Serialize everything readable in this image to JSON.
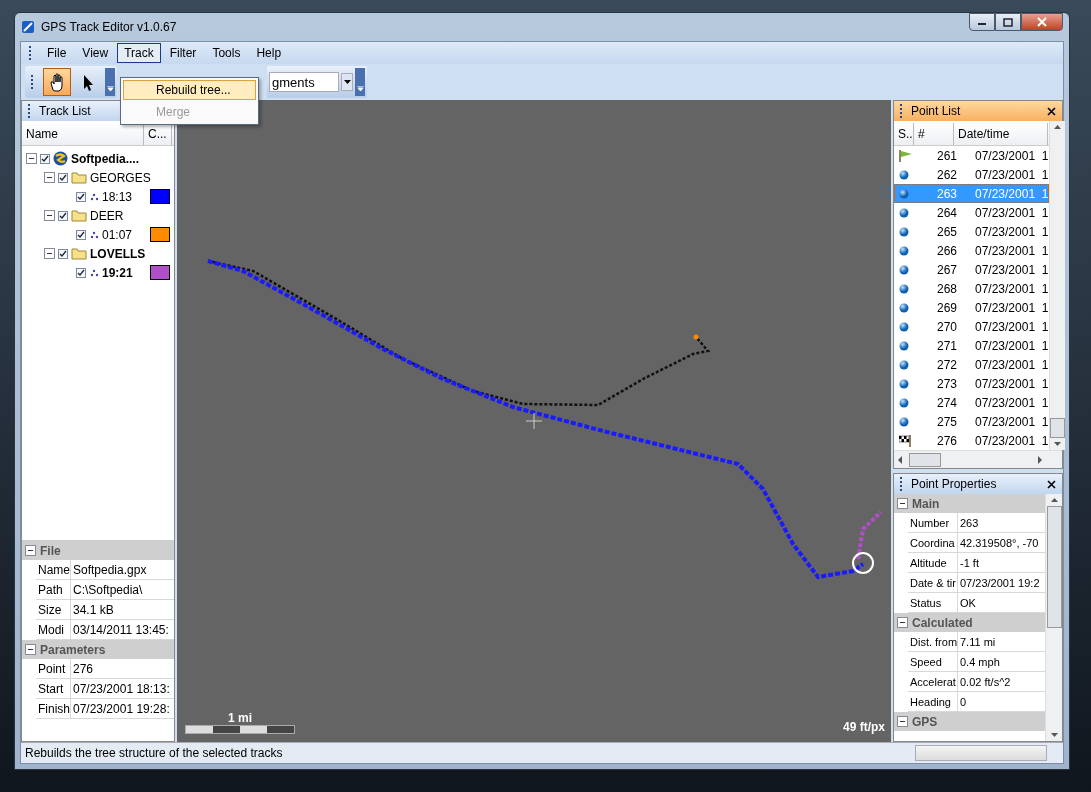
{
  "window": {
    "title": "GPS Track Editor v1.0.67"
  },
  "menu": [
    {
      "label": "File",
      "selected": false
    },
    {
      "label": "View",
      "selected": false
    },
    {
      "label": "Track",
      "selected": true
    },
    {
      "label": "Filter",
      "selected": false
    },
    {
      "label": "Tools",
      "selected": false
    },
    {
      "label": "Help",
      "selected": false
    }
  ],
  "open_menu": {
    "items": [
      {
        "label": "Rebuild tree...",
        "disabled": false,
        "selected": true
      },
      {
        "label": "Merge",
        "disabled": true,
        "selected": false
      }
    ]
  },
  "toolbar": {
    "tools": [
      {
        "kind": "hand",
        "selected": true
      },
      {
        "kind": "pointer",
        "selected": false
      }
    ],
    "combo": {
      "value": "gments"
    }
  },
  "track_list": {
    "title": "Track List",
    "columns": [
      "Name",
      "C..."
    ],
    "tree": [
      {
        "kind": "file",
        "label": "Softpedia....",
        "checked": true,
        "expanded": true,
        "bold": true,
        "children": [
          {
            "kind": "folder",
            "label": "GEORGES",
            "checked": true,
            "expanded": true,
            "bold": false,
            "children": [
              {
                "kind": "track",
                "label": "18:13",
                "checked": true,
                "bold": false,
                "color": "#0000ff"
              }
            ]
          },
          {
            "kind": "folder",
            "label": "DEER",
            "checked": true,
            "expanded": true,
            "bold": false,
            "children": [
              {
                "kind": "track",
                "label": "01:07",
                "checked": true,
                "bold": false,
                "color": "#ff8c00"
              }
            ]
          },
          {
            "kind": "folder",
            "label": "LOVELLS",
            "checked": true,
            "expanded": true,
            "bold": true,
            "children": [
              {
                "kind": "track",
                "label": "19:21",
                "checked": true,
                "bold": true,
                "color": "#b050c8"
              }
            ]
          }
        ]
      }
    ]
  },
  "file_properties": [
    {
      "title": "File",
      "expanded": true,
      "rows": [
        {
          "name": "Name",
          "value": "Softpedia.gpx"
        },
        {
          "name": "Path",
          "value": "C:\\Softpedia\\"
        },
        {
          "name": "Size",
          "value": "34.1 kB"
        },
        {
          "name": "Modi",
          "value": "03/14/2011 13:45:"
        }
      ]
    },
    {
      "title": "Parameters",
      "expanded": true,
      "rows": [
        {
          "name": "Point",
          "value": "276"
        },
        {
          "name": "Start",
          "value": "07/23/2001 18:13:"
        },
        {
          "name": "Finish",
          "value": "07/23/2001 19:28:"
        }
      ]
    }
  ],
  "map": {
    "scale_label": "1 mi",
    "resolution": "49 ft/px"
  },
  "point_list": {
    "title": "Point List",
    "columns": [
      "S..",
      "#",
      "Date/time"
    ],
    "rows": [
      {
        "kind": "start",
        "number": "261",
        "datetime": "07/23/2001  1",
        "selected": false
      },
      {
        "kind": "point",
        "number": "262",
        "datetime": "07/23/2001  1",
        "selected": false
      },
      {
        "kind": "point",
        "number": "263",
        "datetime": "07/23/2001  1",
        "selected": true
      },
      {
        "kind": "point",
        "number": "264",
        "datetime": "07/23/2001  1",
        "selected": false
      },
      {
        "kind": "point",
        "number": "265",
        "datetime": "07/23/2001  1",
        "selected": false
      },
      {
        "kind": "point",
        "number": "266",
        "datetime": "07/23/2001  1",
        "selected": false
      },
      {
        "kind": "point",
        "number": "267",
        "datetime": "07/23/2001  1",
        "selected": false
      },
      {
        "kind": "point",
        "number": "268",
        "datetime": "07/23/2001  1",
        "selected": false
      },
      {
        "kind": "point",
        "number": "269",
        "datetime": "07/23/2001  1",
        "selected": false
      },
      {
        "kind": "point",
        "number": "270",
        "datetime": "07/23/2001  1",
        "selected": false
      },
      {
        "kind": "point",
        "number": "271",
        "datetime": "07/23/2001  1",
        "selected": false
      },
      {
        "kind": "point",
        "number": "272",
        "datetime": "07/23/2001  1",
        "selected": false
      },
      {
        "kind": "point",
        "number": "273",
        "datetime": "07/23/2001  1",
        "selected": false
      },
      {
        "kind": "point",
        "number": "274",
        "datetime": "07/23/2001  1",
        "selected": false
      },
      {
        "kind": "point",
        "number": "275",
        "datetime": "07/23/2001  1",
        "selected": false
      },
      {
        "kind": "finish",
        "number": "276",
        "datetime": "07/23/2001  1",
        "selected": false
      }
    ]
  },
  "point_properties": {
    "title": "Point Properties",
    "sections": [
      {
        "title": "Main",
        "expanded": true,
        "rows": [
          {
            "name": "Number",
            "value": "263"
          },
          {
            "name": "Coordina",
            "value": "42.319508°, -70"
          },
          {
            "name": "Altitude",
            "value": "-1 ft"
          },
          {
            "name": "Date & tir",
            "value": "07/23/2001 19:2"
          },
          {
            "name": "Status",
            "value": "OK"
          }
        ]
      },
      {
        "title": "Calculated",
        "expanded": true,
        "rows": [
          {
            "name": "Dist. from",
            "value": "7.11 mi"
          },
          {
            "name": "Speed",
            "value": "0.4 mph"
          },
          {
            "name": "Accelerat",
            "value": "0.02 ft/s^2"
          },
          {
            "name": "Heading",
            "value": "0"
          }
        ]
      },
      {
        "title": "GPS",
        "expanded": true
      }
    ]
  },
  "status_bar": {
    "text": "Rebuilds the tree structure of the selected tracks"
  }
}
